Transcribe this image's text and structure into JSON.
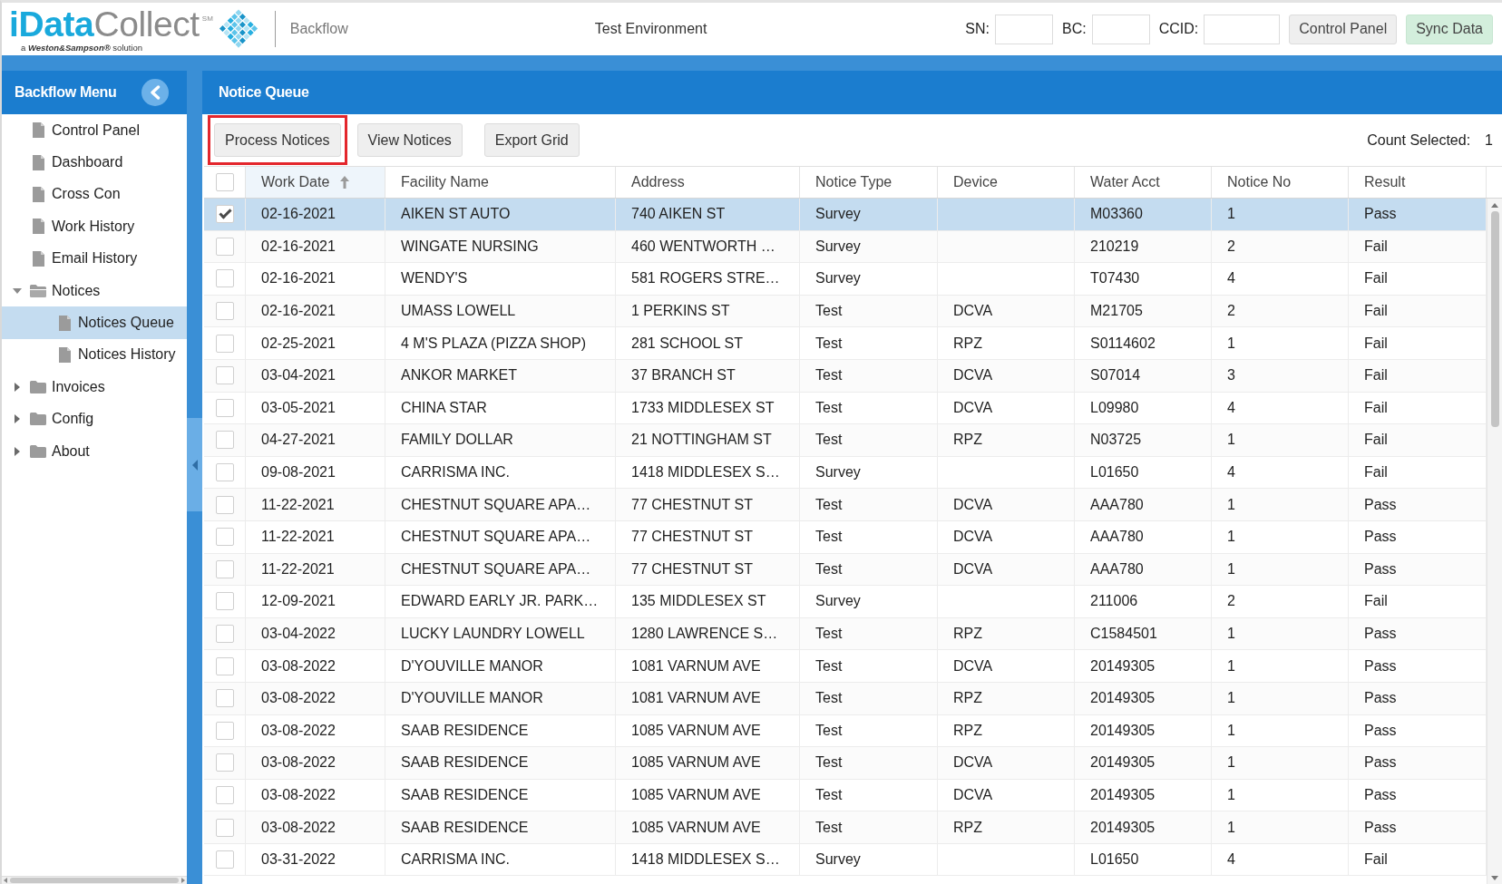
{
  "header": {
    "wordmark_lead": "iData",
    "wordmark_rest": "Collect",
    "service_mark": "SM",
    "tagline": "a *Weston&Sampson®* solution",
    "module": "Backflow",
    "environment": "Test Environment",
    "fields": [
      {
        "label": "SN:"
      },
      {
        "label": "BC:"
      },
      {
        "label": "CCID:"
      }
    ],
    "buttons": [
      {
        "label": "Control Panel",
        "kind": "default"
      },
      {
        "label": "Sync Data",
        "kind": "success"
      }
    ]
  },
  "sidebar": {
    "title": "Backflow Menu",
    "items": [
      {
        "label": "Control Panel",
        "kind": "page",
        "selected": false
      },
      {
        "label": "Dashboard",
        "kind": "page",
        "selected": false
      },
      {
        "label": "Cross Con",
        "kind": "page",
        "selected": false
      },
      {
        "label": "Work History",
        "kind": "page",
        "selected": false
      },
      {
        "label": "Email History",
        "kind": "page",
        "selected": false
      },
      {
        "label": "Notices",
        "kind": "folder",
        "expanded": true,
        "selected": false,
        "children": [
          {
            "label": "Notices Queue",
            "kind": "page",
            "selected": true
          },
          {
            "label": "Notices History",
            "kind": "page",
            "selected": false
          }
        ]
      },
      {
        "label": "Invoices",
        "kind": "folder",
        "expanded": false,
        "selected": false
      },
      {
        "label": "Config",
        "kind": "folder",
        "expanded": false,
        "selected": false
      },
      {
        "label": "About",
        "kind": "folder",
        "expanded": false,
        "selected": false
      }
    ]
  },
  "panel": {
    "title": "Notice Queue",
    "toolbar": [
      {
        "label": "Process Notices",
        "highlighted": true
      },
      {
        "label": "View Notices",
        "highlighted": false
      },
      {
        "label": "Export Grid",
        "highlighted": false
      }
    ],
    "count_label": "Count Selected:",
    "count": "1"
  },
  "table": {
    "select_all_checked": false,
    "columns": [
      {
        "label": "Work Date",
        "sorted": true
      },
      {
        "label": "Facility Name",
        "sorted": false
      },
      {
        "label": "Address",
        "sorted": false
      },
      {
        "label": "Notice Type",
        "sorted": false
      },
      {
        "label": "Device",
        "sorted": false
      },
      {
        "label": "Water Acct",
        "sorted": false
      },
      {
        "label": "Notice No",
        "sorted": false
      },
      {
        "label": "Result",
        "sorted": false
      }
    ],
    "rows": [
      {
        "checked": true,
        "selected": true,
        "work_date": "02-16-2021",
        "facility_name": "AIKEN ST AUTO",
        "address": "740 AIKEN ST",
        "notice_type": "Survey",
        "water_acct": "M03360",
        "notice_no": "1",
        "result": "Pass"
      },
      {
        "checked": false,
        "selected": false,
        "work_date": "02-16-2021",
        "facility_name": "WINGATE NURSING",
        "address": "460 WENTWORTH …",
        "notice_type": "Survey",
        "water_acct": "210219",
        "notice_no": "2",
        "result": "Fail"
      },
      {
        "checked": false,
        "selected": false,
        "work_date": "02-16-2021",
        "facility_name": "WENDY'S",
        "address": "581 ROGERS STRE…",
        "notice_type": "Survey",
        "water_acct": "T07430",
        "notice_no": "4",
        "result": "Fail"
      },
      {
        "checked": false,
        "selected": false,
        "work_date": "02-16-2021",
        "facility_name": "UMASS LOWELL",
        "address": "1 PERKINS ST",
        "notice_type": "Test",
        "device": "DCVA",
        "water_acct": "M21705",
        "notice_no": "2",
        "result": "Fail"
      },
      {
        "checked": false,
        "selected": false,
        "work_date": "02-25-2021",
        "facility_name": "4 M'S PLAZA (PIZZA SHOP)",
        "address": "281 SCHOOL ST",
        "notice_type": "Test",
        "device": "RPZ",
        "water_acct": "S0114602",
        "notice_no": "1",
        "result": "Fail"
      },
      {
        "checked": false,
        "selected": false,
        "work_date": "03-04-2021",
        "facility_name": "ANKOR MARKET",
        "address": "37 BRANCH ST",
        "notice_type": "Test",
        "device": "DCVA",
        "water_acct": "S07014",
        "notice_no": "3",
        "result": "Fail"
      },
      {
        "checked": false,
        "selected": false,
        "work_date": "03-05-2021",
        "facility_name": "CHINA STAR",
        "address": "1733 MIDDLESEX ST",
        "notice_type": "Test",
        "device": "DCVA",
        "water_acct": "L09980",
        "notice_no": "4",
        "result": "Fail"
      },
      {
        "checked": false,
        "selected": false,
        "work_date": "04-27-2021",
        "facility_name": "FAMILY DOLLAR",
        "address": "21 NOTTINGHAM ST",
        "notice_type": "Test",
        "device": "RPZ",
        "water_acct": "N03725",
        "notice_no": "1",
        "result": "Fail"
      },
      {
        "checked": false,
        "selected": false,
        "work_date": "09-08-2021",
        "facility_name": "CARRISMA INC.",
        "address": "1418 MIDDLESEX S…",
        "notice_type": "Survey",
        "water_acct": "L01650",
        "notice_no": "4",
        "result": "Fail"
      },
      {
        "checked": false,
        "selected": false,
        "work_date": "11-22-2021",
        "facility_name": "CHESTNUT SQUARE APA…",
        "address": "77 CHESTNUT ST",
        "notice_type": "Test",
        "device": "DCVA",
        "water_acct": "AAA780",
        "notice_no": "1",
        "result": "Pass"
      },
      {
        "checked": false,
        "selected": false,
        "work_date": "11-22-2021",
        "facility_name": "CHESTNUT SQUARE APA…",
        "address": "77 CHESTNUT ST",
        "notice_type": "Test",
        "device": "DCVA",
        "water_acct": "AAA780",
        "notice_no": "1",
        "result": "Pass"
      },
      {
        "checked": false,
        "selected": false,
        "work_date": "11-22-2021",
        "facility_name": "CHESTNUT SQUARE APA…",
        "address": "77 CHESTNUT ST",
        "notice_type": "Test",
        "device": "DCVA",
        "water_acct": "AAA780",
        "notice_no": "1",
        "result": "Pass"
      },
      {
        "checked": false,
        "selected": false,
        "work_date": "12-09-2021",
        "facility_name": "EDWARD EARLY JR. PARK…",
        "address": "135 MIDDLESEX ST",
        "notice_type": "Survey",
        "water_acct": "211006",
        "notice_no": "2",
        "result": "Fail"
      },
      {
        "checked": false,
        "selected": false,
        "work_date": "03-04-2022",
        "facility_name": "LUCKY LAUNDRY LOWELL",
        "address": "1280 LAWRENCE S…",
        "notice_type": "Test",
        "device": "RPZ",
        "water_acct": "C1584501",
        "notice_no": "1",
        "result": "Pass"
      },
      {
        "checked": false,
        "selected": false,
        "work_date": "03-08-2022",
        "facility_name": "D'YOUVILLE MANOR",
        "address": "1081 VARNUM AVE",
        "notice_type": "Test",
        "device": "DCVA",
        "water_acct": "20149305",
        "notice_no": "1",
        "result": "Pass"
      },
      {
        "checked": false,
        "selected": false,
        "work_date": "03-08-2022",
        "facility_name": "D'YOUVILLE MANOR",
        "address": "1081 VARNUM AVE",
        "notice_type": "Test",
        "device": "RPZ",
        "water_acct": "20149305",
        "notice_no": "1",
        "result": "Pass"
      },
      {
        "checked": false,
        "selected": false,
        "work_date": "03-08-2022",
        "facility_name": "SAAB RESIDENCE",
        "address": "1085 VARNUM AVE",
        "notice_type": "Test",
        "device": "RPZ",
        "water_acct": "20149305",
        "notice_no": "1",
        "result": "Pass"
      },
      {
        "checked": false,
        "selected": false,
        "work_date": "03-08-2022",
        "facility_name": "SAAB RESIDENCE",
        "address": "1085 VARNUM AVE",
        "notice_type": "Test",
        "device": "DCVA",
        "water_acct": "20149305",
        "notice_no": "1",
        "result": "Pass"
      },
      {
        "checked": false,
        "selected": false,
        "work_date": "03-08-2022",
        "facility_name": "SAAB RESIDENCE",
        "address": "1085 VARNUM AVE",
        "notice_type": "Test",
        "device": "DCVA",
        "water_acct": "20149305",
        "notice_no": "1",
        "result": "Pass"
      },
      {
        "checked": false,
        "selected": false,
        "work_date": "03-08-2022",
        "facility_name": "SAAB RESIDENCE",
        "address": "1085 VARNUM AVE",
        "notice_type": "Test",
        "device": "RPZ",
        "water_acct": "20149305",
        "notice_no": "1",
        "result": "Pass"
      },
      {
        "checked": false,
        "selected": false,
        "work_date": "03-31-2022",
        "facility_name": "CARRISMA INC.",
        "address": "1418 MIDDLESEX S…",
        "notice_type": "Survey",
        "water_acct": "L01650",
        "notice_no": "4",
        "result": "Fail"
      }
    ]
  }
}
